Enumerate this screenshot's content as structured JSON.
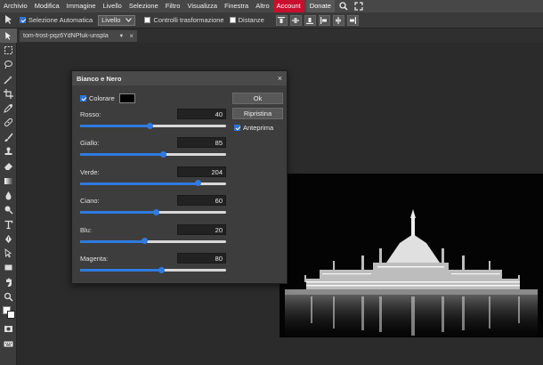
{
  "menu": {
    "items": [
      "Archivio",
      "Modifica",
      "Immagine",
      "Livello",
      "Selezione",
      "Filtro",
      "Visualizza",
      "Finestra",
      "Altro"
    ],
    "account_label": "Account",
    "donate_label": "Donate",
    "icons": [
      "search-icon",
      "fullscreen-icon"
    ]
  },
  "options": {
    "auto_select_label": "Selezione Automatica",
    "auto_select_checked": true,
    "layer_select_value": "Livello",
    "transform_controls_label": "Controlli trasformazione",
    "transform_controls_checked": false,
    "distances_label": "Distanze",
    "distances_checked": false
  },
  "document": {
    "tab_name": "tom-frost-pqz6YdNPfuk-unspla",
    "tab_arrow": "▼",
    "tab_close": "×"
  },
  "tools": [
    "move-tool-icon",
    "marquee-tool-icon",
    "lasso-tool-icon",
    "magic-wand-tool-icon",
    "crop-tool-icon",
    "eyedropper-tool-icon",
    "healing-tool-icon",
    "brush-tool-icon",
    "clone-stamp-tool-icon",
    "eraser-tool-icon",
    "gradient-tool-icon",
    "blur-tool-icon",
    "dodge-tool-icon",
    "type-tool-icon",
    "pen-tool-icon",
    "path-select-tool-icon",
    "shape-tool-icon",
    "hand-tool-icon",
    "zoom-tool-icon"
  ],
  "dialog": {
    "title": "Bianco e Nero",
    "close": "×",
    "colorize_label": "Colorare",
    "colorize_checked": true,
    "colorize_swatch": "#000000",
    "sliders": [
      {
        "label": "Rosso:",
        "value": "40"
      },
      {
        "label": "Giallo:",
        "value": "85"
      },
      {
        "label": "Verde:",
        "value": "204"
      },
      {
        "label": "Ciano:",
        "value": "60"
      },
      {
        "label": "Blu:",
        "value": "20"
      },
      {
        "label": "Magenta:",
        "value": "80"
      }
    ],
    "ok_label": "Ok",
    "reset_label": "Ripristina",
    "preview_label": "Anteprima",
    "preview_checked": true
  },
  "colors": {
    "accent": "#2f7be0",
    "account": "#c8102e",
    "menubar": "#474747",
    "panel": "#3d3d3d"
  }
}
